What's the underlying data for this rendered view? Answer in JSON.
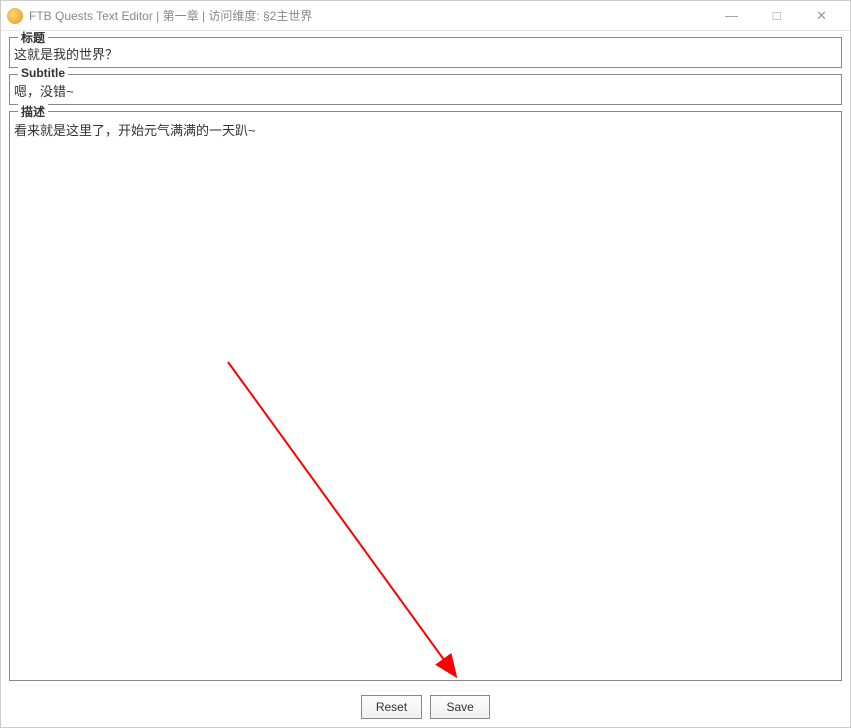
{
  "titlebar": {
    "title": "FTB Quests Text Editor | 第一章 | 访问维度: §2主世界"
  },
  "fields": {
    "title": {
      "legend": "标题",
      "value": "这就是我的世界？"
    },
    "subtitle": {
      "legend": "Subtitle",
      "value": "嗯，没错~"
    },
    "description": {
      "legend": "描述",
      "value": "看来就是这里了，开始元气满满的一天趴~"
    }
  },
  "buttons": {
    "reset": "Reset",
    "save": "Save"
  },
  "window_controls": {
    "minimize": "—",
    "maximize": "□",
    "close": "✕"
  }
}
